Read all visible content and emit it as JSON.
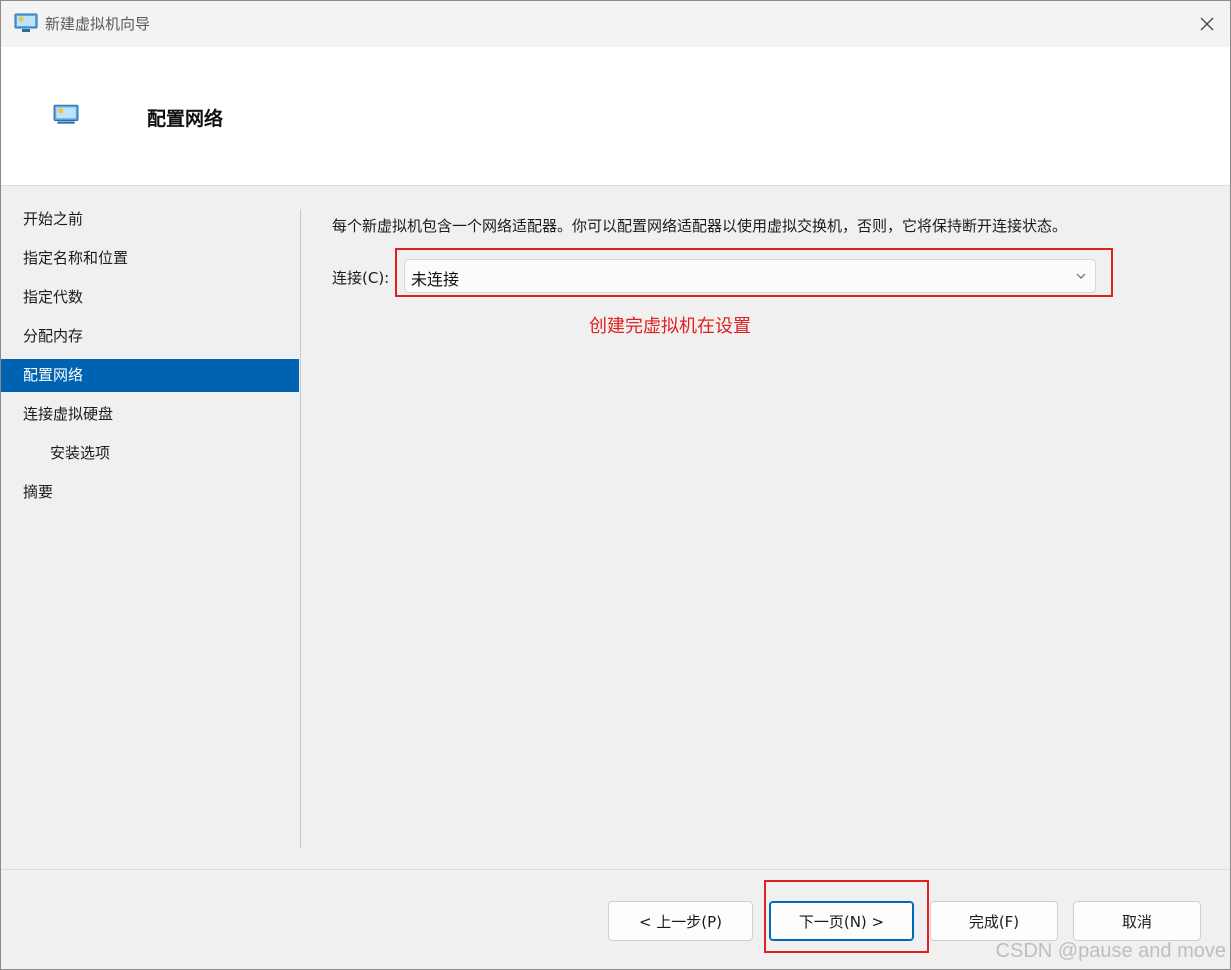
{
  "window": {
    "title": "新建虚拟机向导"
  },
  "header": {
    "title": "配置网络"
  },
  "nav": {
    "items": [
      {
        "label": "开始之前"
      },
      {
        "label": "指定名称和位置"
      },
      {
        "label": "指定代数"
      },
      {
        "label": "分配内存"
      },
      {
        "label": "配置网络"
      },
      {
        "label": "连接虚拟硬盘"
      },
      {
        "label": "安装选项"
      },
      {
        "label": "摘要"
      }
    ]
  },
  "main": {
    "description": "每个新虚拟机包含一个网络适配器。你可以配置网络适配器以使用虚拟交换机，否则，它将保持断开连接状态。",
    "connection_label": "连接(C):",
    "connection_value": "未连接",
    "annotation": "创建完虚拟机在设置"
  },
  "footer": {
    "prev": "< 上一步(P)",
    "next": "下一页(N) >",
    "finish": "完成(F)",
    "cancel": "取消"
  },
  "watermark": "CSDN @pause and move",
  "colors": {
    "accent": "#0063b1",
    "annotation": "#e02020"
  }
}
